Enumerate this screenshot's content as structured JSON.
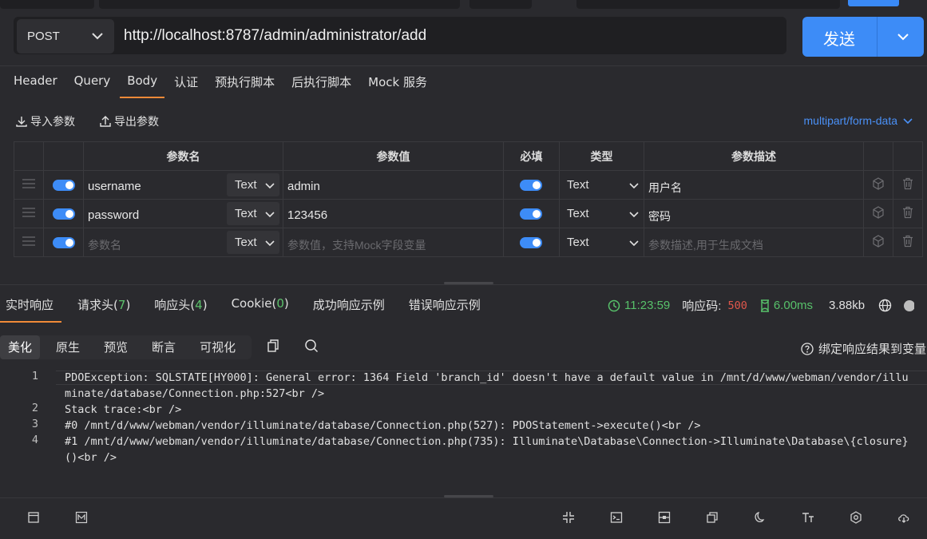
{
  "request": {
    "method": "POST",
    "url": "http://localhost:8787/admin/administrator/add",
    "send_label": "发送"
  },
  "req_tabs": [
    "Header",
    "Query",
    "Body",
    "认证",
    "预执行脚本",
    "后执行脚本",
    "Mock 服务"
  ],
  "body_toolbar": {
    "import": "导入参数",
    "export": "导出参数",
    "content_type": "multipart/form-data"
  },
  "table": {
    "headers": {
      "name": "参数名",
      "value": "参数值",
      "required": "必填",
      "type": "类型",
      "desc": "参数描述"
    },
    "rows": [
      {
        "name": "username",
        "name_type": "Text",
        "value": "admin",
        "type": "Text",
        "desc": "用户名"
      },
      {
        "name": "password",
        "name_type": "Text",
        "value": "123456",
        "type": "Text",
        "desc": "密码"
      }
    ],
    "placeholder_row": {
      "name": "参数名",
      "name_type": "Text",
      "value": "参数值，支持Mock字段变量",
      "type": "Text",
      "desc": "参数描述,用于生成文档"
    }
  },
  "resp_tabs": {
    "realtime": "实时响应",
    "req_headers": "请求头",
    "req_headers_count": "7",
    "resp_headers": "响应头",
    "resp_headers_count": "4",
    "cookie": "Cookie",
    "cookie_count": "0",
    "success_example": "成功响应示例",
    "error_example": "错误响应示例"
  },
  "stats": {
    "time": "11:23:59",
    "code_label": "响应码:",
    "code": "500",
    "duration": "6.00ms",
    "size": "3.88kb"
  },
  "view_buttons": [
    "美化",
    "原生",
    "预览",
    "断言",
    "可视化"
  ],
  "bind_label": "绑定响应结果到变量",
  "code_lines": [
    {
      "n": "1",
      "text": "PDOException: SQLSTATE[HY000]: General error: 1364 Field 'branch_id' doesn't have a default value in /mnt/d/www/webman/vendor/illuminate/database/Connection.php:527<br />"
    },
    {
      "n": "2",
      "text": "Stack trace:<br />"
    },
    {
      "n": "3",
      "text": "#0 /mnt/d/www/webman/vendor/illuminate/database/Connection.php(527): PDOStatement->execute()<br />"
    },
    {
      "n": "4",
      "text": "#1 /mnt/d/www/webman/vendor/illuminate/database/Connection.php(735): Illuminate\\Database\\Connection->Illuminate\\Database\\{closure}()<br />"
    }
  ],
  "colors": {
    "accent": "#3d8cf7",
    "tab_active": "#f08a38",
    "success": "#57c16a",
    "error": "#e0574c"
  }
}
